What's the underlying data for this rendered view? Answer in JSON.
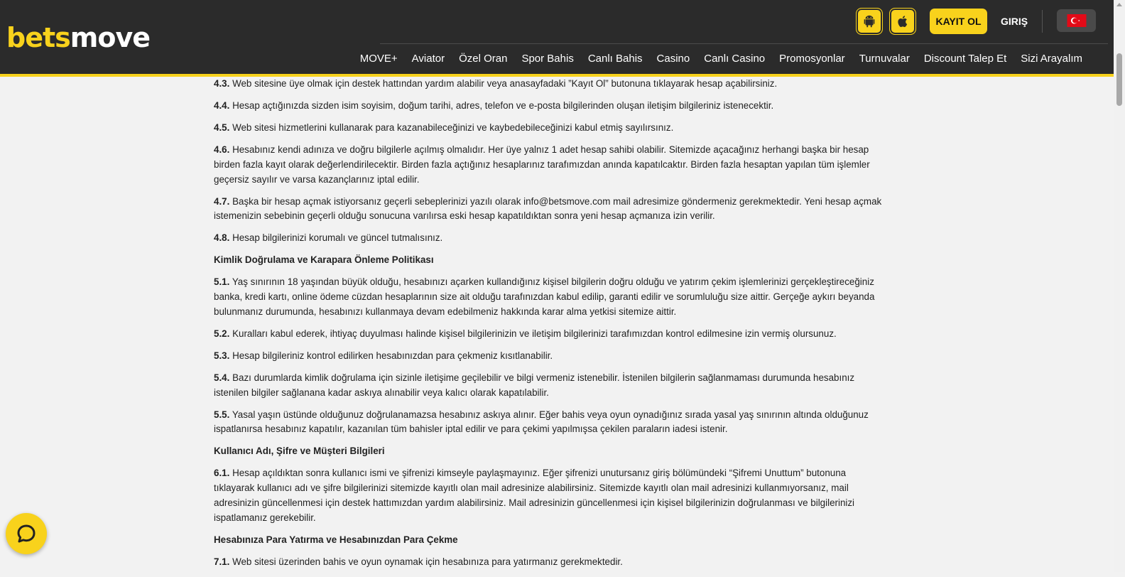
{
  "brand": {
    "logo_part1": "bets",
    "logo_part2": "move"
  },
  "header": {
    "android_icon": "android-icon",
    "apple_icon": "apple-icon",
    "register_label": "KAYIT OL",
    "login_label": "GIRIŞ",
    "language_icon": "turkey-flag-icon"
  },
  "nav": {
    "items": [
      "MOVE+",
      "Aviator",
      "Özel Oran",
      "Spor Bahis",
      "Canlı Bahis",
      "Casino",
      "Canlı Casino",
      "Promosyonlar",
      "Turnuvalar",
      "Discount Talep Et",
      "Sizi Arayalım"
    ]
  },
  "content": [
    {
      "type": "p",
      "num": "4.3.",
      "text": " Web sitesine üye olmak için destek hattından yardım alabilir veya anasayfadaki ”Kayıt Ol” butonuna tıklayarak hesap açabilirsiniz."
    },
    {
      "type": "p",
      "num": "4.4.",
      "text": " Hesap açtığınızda sizden isim soyisim, doğum tarihi, adres, telefon ve e-posta bilgilerinden oluşan iletişim bilgileriniz istenecektir."
    },
    {
      "type": "p",
      "num": "4.5.",
      "text": " Web sitesi hizmetlerini kullanarak para kazanabileceğinizi ve kaybedebileceğinizi kabul etmiş sayılırsınız."
    },
    {
      "type": "p",
      "num": "4.6.",
      "text": " Hesabınız kendi adınıza ve doğru bilgilerle açılmış olmalıdır. Her üye yalnız 1 adet hesap sahibi olabilir. Sitemizde açacağınız herhangi başka bir hesap birden fazla kayıt olarak değerlendirilecektir. Birden fazla açtığınız hesaplarınız tarafımızdan anında kapatılcaktır. Birden fazla hesaptan yapılan tüm işlemler geçersiz sayılır ve varsa kazançlarınız iptal edilir."
    },
    {
      "type": "p",
      "num": "4.7.",
      "text": " Başka bir hesap açmak istiyorsanız geçerli sebeplerinizi yazılı olarak info@betsmove.com mail adresimize göndermeniz gerekmektedir. Yeni hesap açmak istemenizin sebebinin geçerli olduğu sonucuna varılırsa eski hesap kapatıldıktan sonra yeni hesap açmanıza izin verilir."
    },
    {
      "type": "p",
      "num": "4.8.",
      "text": " Hesap bilgilerinizi korumalı ve güncel tutmalısınız."
    },
    {
      "type": "h",
      "text": "Kimlik Doğrulama ve Karapara Önleme Politikası"
    },
    {
      "type": "p",
      "num": "5.1.",
      "text": " Yaş sınırının 18 yaşından büyük olduğu, hesabınızı açarken kullandığınız kişisel bilgilerin doğru olduğu ve yatırım çekim işlemlerinizi gerçekleştireceğiniz banka, kredi kartı, online ödeme cüzdan hesaplarının size ait olduğu tarafınızdan kabul edilip, garanti edilir ve sorumluluğu size aittir. Gerçeğe aykırı beyanda bulunmanız durumunda, hesabınızı kullanmaya devam edebilmeniz hakkında karar alma yetkisi sitemize aittir."
    },
    {
      "type": "p",
      "num": "5.2.",
      "text": " Kuralları kabul ederek, ihtiyaç duyulması halinde kişisel bilgilerinizin ve iletişim bilgilerinizi tarafımızdan kontrol edilmesine izin vermiş olursunuz."
    },
    {
      "type": "p",
      "num": "5.3.",
      "text": " Hesap bilgileriniz kontrol edilirken hesabınızdan para çekmeniz kısıtlanabilir."
    },
    {
      "type": "p",
      "num": "5.4.",
      "text": " Bazı durumlarda kimlik doğrulama için sizinle iletişime geçilebilir ve bilgi vermeniz istenebilir. İstenilen bilgilerin sağlanmaması durumunda hesabınız istenilen bilgiler sağlanana kadar askıya alınabilir veya kalıcı olarak kapatılabilir."
    },
    {
      "type": "p",
      "num": "5.5.",
      "text": " Yasal yaşın üstünde olduğunuz doğrulanamazsa hesabınız askıya alınır. Eğer bahis veya oyun oynadığınız sırada yasal yaş sınırının altında olduğunuz ispatlanırsa hesabınız kapatılır, kazanılan tüm bahisler iptal edilir ve para çekimi yapılmışsa çekilen paraların iadesi istenir."
    },
    {
      "type": "h",
      "text": "Kullanıcı Adı, Şifre ve Müşteri Bilgileri"
    },
    {
      "type": "p",
      "num": "6.1.",
      "text": " Hesap açıldıktan sonra kullanıcı ismi ve şifrenizi kimseyle paylaşmayınız. Eğer şifrenizi unutursanız giriş bölümündeki “Şifremi Unuttum” butonuna tıklayarak kullanıcı adı ve şifre bilgilerinizi sitemizde kayıtlı olan mail adresinize alabilirsiniz. Sitemizde kayıtlı olan mail adresinizi kullanmıyorsanız, mail adresinizin güncellenmesi için destek hattımızdan yardım alabilirsiniz. Mail adresinizin güncellenmesi için kişisel bilgilerinizin doğrulanması ve bilgilerinizi ispatlamanız gerekebilir."
    },
    {
      "type": "h",
      "text": "Hesabınıza Para Yatırma ve Hesabınızdan Para Çekme"
    },
    {
      "type": "p",
      "num": "7.1.",
      "text": " Web sitesi üzerinden bahis ve oyun oynamak için hesabınıza para yatırmanız gerekmektedir."
    }
  ],
  "chat": {
    "icon": "chat-bubble-icon"
  }
}
